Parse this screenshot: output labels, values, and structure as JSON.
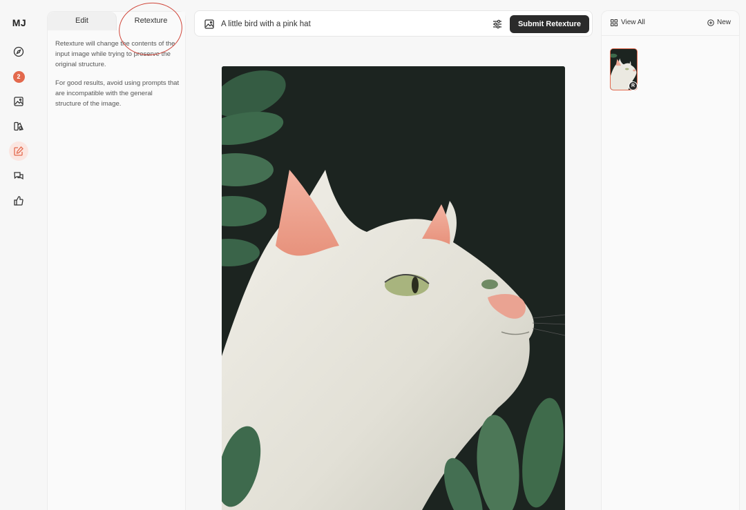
{
  "app": {
    "logo": "MJ"
  },
  "rail": {
    "items": [
      {
        "icon": "compass-icon"
      },
      {
        "icon": "notification-badge",
        "count": "2"
      },
      {
        "icon": "image-icon"
      },
      {
        "icon": "organize-icon"
      },
      {
        "icon": "edit-icon",
        "active": true
      },
      {
        "icon": "chat-icon"
      },
      {
        "icon": "thumbs-up-icon"
      }
    ]
  },
  "edit_panel": {
    "tabs": [
      {
        "label": "Edit",
        "active": false
      },
      {
        "label": "Retexture",
        "active": true
      }
    ],
    "paragraphs": [
      "Retexture will change the contents of the input image while trying to preserve the original structure.",
      "For good results, avoid using prompts that are incompatible with the general structure of the image."
    ]
  },
  "prompt": {
    "value": "A little bird with a pink hat",
    "submit_label": "Submit Retexture"
  },
  "right_panel": {
    "view_all_label": "View All",
    "new_label": "New",
    "thumb_badge": "R"
  },
  "colors": {
    "accent": "#e3694d",
    "annotation": "#d0463a",
    "button_dark": "#2b2b2b"
  }
}
